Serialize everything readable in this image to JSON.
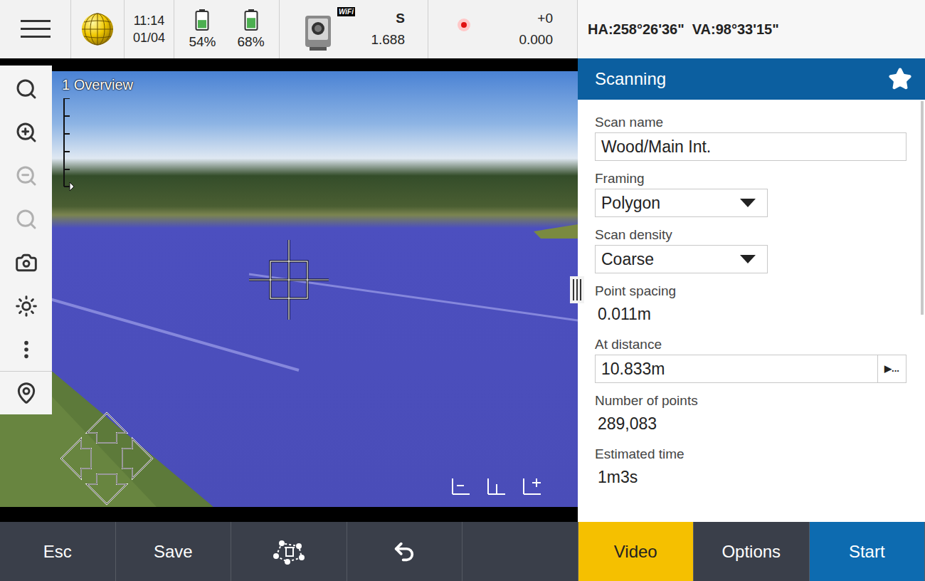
{
  "top_bar": {
    "time": "11:14",
    "date": "01/04",
    "batteries": [
      {
        "reading": "54%",
        "level": 0.54
      },
      {
        "reading": "68%",
        "level": 0.68
      }
    ],
    "instrument": {
      "badge": "WiFi",
      "target": "S",
      "height": "1.688"
    },
    "laser": {
      "prism_constant": "+0",
      "value": "0.000"
    },
    "angles": "HA:258°26'36\"  VA:98°33'15\""
  },
  "video": {
    "label": "1 Overview"
  },
  "toolbar": [
    {
      "kind": "extents",
      "disabled": false
    },
    {
      "kind": "zoomin",
      "disabled": false
    },
    {
      "kind": "zoomout",
      "disabled": true
    },
    {
      "kind": "previous",
      "disabled": true
    },
    {
      "kind": "camera",
      "disabled": false
    },
    {
      "kind": "brightness",
      "disabled": false
    },
    {
      "kind": "more",
      "disabled": false
    },
    {
      "kind": "map",
      "disabled": false
    }
  ],
  "panel": {
    "title": "Scanning",
    "favorite": true,
    "fields": [
      {
        "label": "Scan name",
        "value": "Wood/Main Int.",
        "kind": "input"
      },
      {
        "label": "Framing",
        "value": "Polygon",
        "kind": "dropdown"
      },
      {
        "label": "Scan density",
        "value": "Coarse",
        "kind": "dropdown"
      },
      {
        "label": "Point spacing",
        "value": "0.011m",
        "kind": "static"
      },
      {
        "label": "At distance",
        "value": "10.833m",
        "kind": "picker",
        "button": "▶..."
      },
      {
        "label": "Number of points",
        "value": "289,083",
        "kind": "static"
      },
      {
        "label": "Estimated time",
        "value": "1m3s",
        "kind": "static"
      }
    ]
  },
  "buttons": [
    {
      "label": "Esc",
      "kind": "text"
    },
    {
      "label": "Save",
      "kind": "text"
    },
    {
      "label": "",
      "kind": "delete"
    },
    {
      "label": "",
      "kind": "undo"
    },
    {
      "label": "",
      "kind": "blank"
    },
    {
      "label": "Video",
      "kind": "accent"
    },
    {
      "label": "Options",
      "kind": "text"
    },
    {
      "label": "Start",
      "kind": "primary"
    }
  ]
}
